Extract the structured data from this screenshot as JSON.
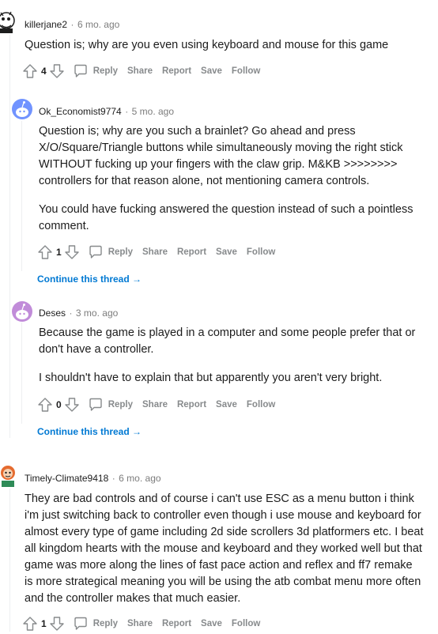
{
  "comments": [
    {
      "username": "killerjane2",
      "age": "6 mo. ago",
      "body": [
        "Question is; why are you even using keyboard and mouse for this game"
      ],
      "votes": "4"
    },
    {
      "username": "Ok_Economist9774",
      "age": "5 mo. ago",
      "body": [
        "Question is; why are you such a brainlet? Go ahead and press X/O/Square/Triangle buttons while simultaneously moving the right stick WITHOUT fucking up your fingers with the claw grip. M&KB >>>>>>>> controllers for that reason alone, not mentioning camera controls.",
        "You could have fucking answered the question instead of such a pointless comment."
      ],
      "votes": "1",
      "continue": "Continue this thread"
    },
    {
      "username": "Deses",
      "age": "3 mo. ago",
      "body": [
        "Because the game is played in a computer and some people prefer that or don't have a controller.",
        "I shouldn't have to explain that but apparently you aren't very bright."
      ],
      "votes": "0",
      "continue": "Continue this thread"
    },
    {
      "username": "Timely-Climate9418",
      "age": "6 mo. ago",
      "body": [
        "They are bad controls and of course i can't use ESC as a menu button i think i'm just switching back to controller even though i use mouse and keyboard for almost every type of game including 2d side scrollers 3d platformers etc. I beat all kingdom hearts with the mouse and keyboard and they worked well but that game was more along the lines of fast pace action and reflex and ff7 remake is more strategical meaning you will be using the atb combat menu more often and the controller makes that much easier."
      ],
      "votes": "1"
    }
  ],
  "actions": {
    "reply": "Reply",
    "share": "Share",
    "report": "Report",
    "save": "Save",
    "follow": "Follow"
  },
  "separator": "·",
  "arrow": "→",
  "colors": {
    "link": "#0079d3",
    "action": "#878a8c",
    "meta": "#7c7c7c",
    "thread_line": "#edeff1"
  },
  "icons": [
    "upvote-icon",
    "downvote-icon",
    "comment-bubble-icon",
    "avatar-icon"
  ]
}
